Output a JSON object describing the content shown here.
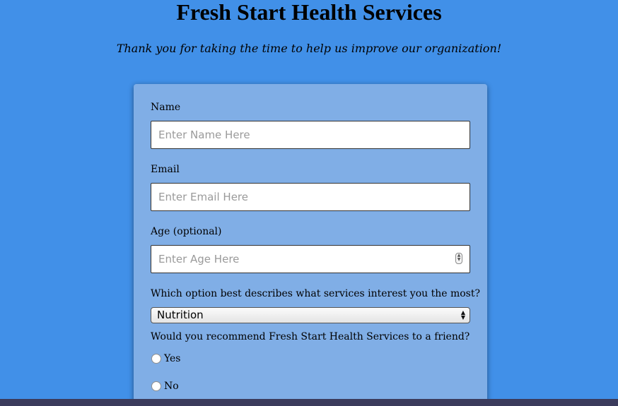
{
  "header": {
    "title": "Fresh Start Health Services",
    "subtitle": "Thank you for taking the time to help us improve our organization!"
  },
  "form": {
    "name": {
      "label": "Name",
      "placeholder": "Enter Name Here",
      "value": ""
    },
    "email": {
      "label": "Email",
      "placeholder": "Enter Email Here",
      "value": ""
    },
    "age": {
      "label": "Age (optional)",
      "placeholder": "Enter Age Here",
      "value": ""
    },
    "services": {
      "label": "Which option best describes what services interest you the most?",
      "selected": "Nutrition"
    },
    "recommend": {
      "label": "Would you recommend Fresh Start Health Services to a friend?",
      "options": [
        {
          "label": "Yes",
          "checked": false
        },
        {
          "label": "No",
          "checked": false
        }
      ]
    }
  },
  "colors": {
    "page_background": "#4190e8",
    "card_background": "#80aee6"
  }
}
